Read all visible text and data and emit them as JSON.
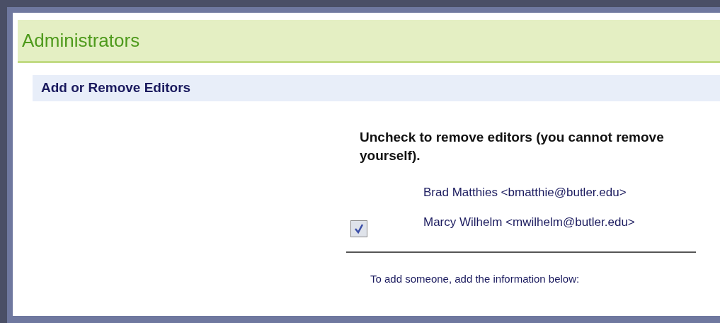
{
  "page_title": "Administrators",
  "section_title": "Add or Remove Editors",
  "instructions": "Uncheck to remove editors (you cannot remove yourself).",
  "editors": [
    {
      "kind": "self",
      "label": "Brad Matthies <bmatthie@butler.edu>"
    },
    {
      "kind": "removable",
      "label": "Marcy Wilhelm <mwilhelm@butler.edu>",
      "checked": true
    }
  ],
  "add_hint": "To add someone, add the information below:"
}
